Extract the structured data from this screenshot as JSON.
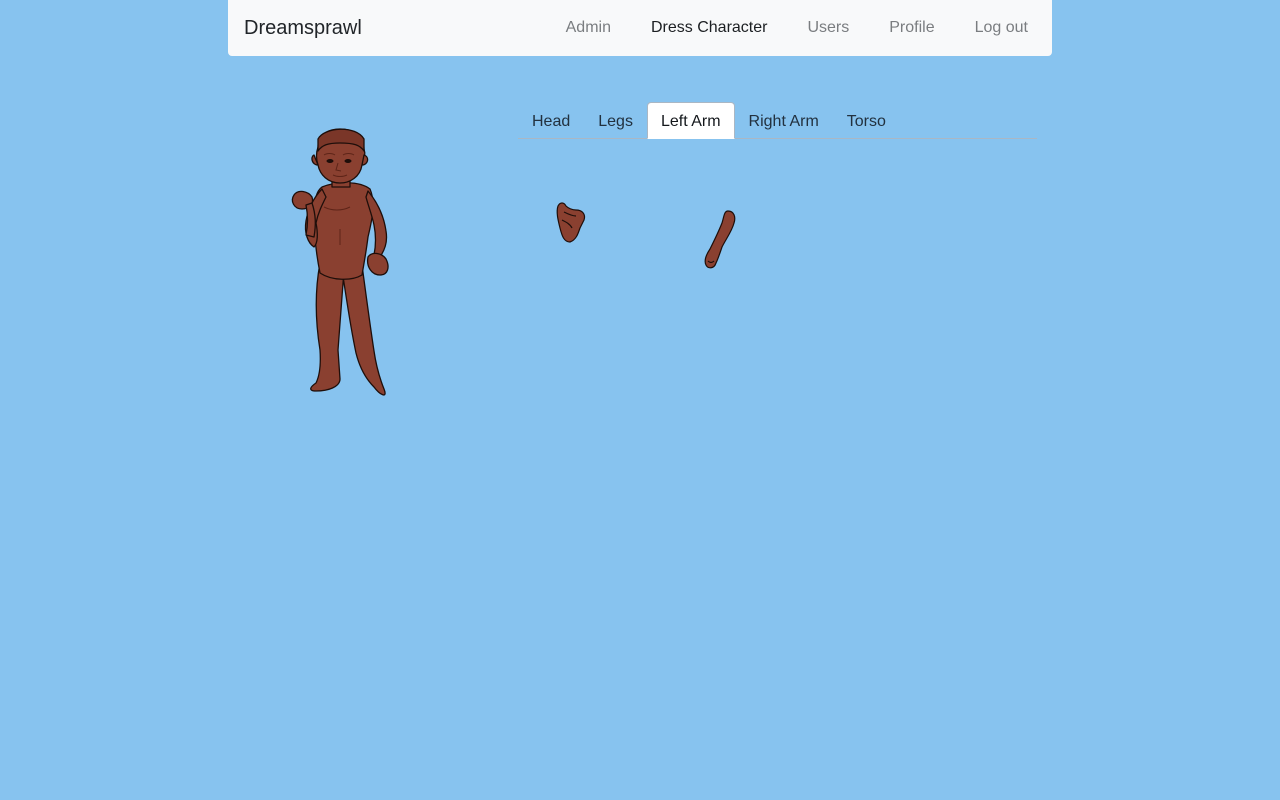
{
  "navbar": {
    "brand": "Dreamsprawl",
    "links": [
      {
        "label": "Admin"
      },
      {
        "label": "Dress Character"
      },
      {
        "label": "Users"
      },
      {
        "label": "Profile"
      },
      {
        "label": "Log out"
      }
    ],
    "active_link": "Dress Character"
  },
  "tabs": [
    {
      "label": "Head"
    },
    {
      "label": "Legs"
    },
    {
      "label": "Left Arm"
    },
    {
      "label": "Right Arm"
    },
    {
      "label": "Torso"
    }
  ],
  "active_tab": "Left Arm",
  "colors": {
    "background": "#87c3ef",
    "skin": "#8a4030",
    "skin_shadow": "#5e2418",
    "outline": "#1e0e0a"
  }
}
